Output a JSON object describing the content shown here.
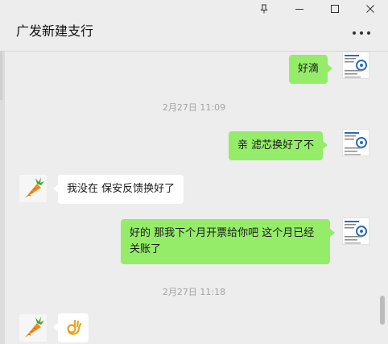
{
  "window": {
    "controls": [
      "pin-icon",
      "minimize-icon",
      "maximize-icon",
      "close-icon"
    ]
  },
  "header": {
    "title": "广发新建支行",
    "more_icon": "more-horizontal-icon"
  },
  "messages": [
    {
      "type": "message",
      "sender": "me",
      "text": "好滴"
    },
    {
      "type": "timestamp",
      "text": "2月27日 11:09"
    },
    {
      "type": "message",
      "sender": "me",
      "text": "亲 滤芯换好了不"
    },
    {
      "type": "message",
      "sender": "other",
      "text": "我没在 保安反馈换好了"
    },
    {
      "type": "message",
      "sender": "me",
      "text": "好的 那我下个月开票给你吧 这个月已经关账了"
    },
    {
      "type": "timestamp",
      "text": "2月27日 11:18"
    },
    {
      "type": "message",
      "sender": "other",
      "text": "👌",
      "emoji": "ok-hand"
    }
  ],
  "colors": {
    "background": "#ededed",
    "my_bubble": "#95ec69",
    "other_bubble": "#ffffff",
    "timestamp_text": "#a3a3a3"
  }
}
